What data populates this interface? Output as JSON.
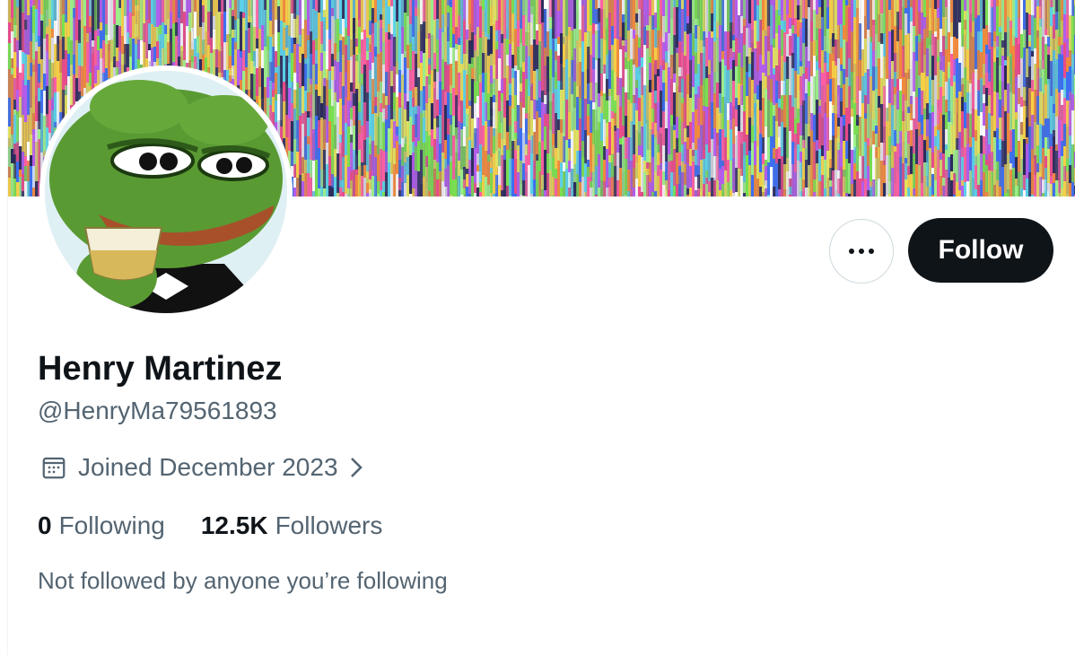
{
  "profile": {
    "display_name": "Henry Martinez",
    "handle": "@HenryMa79561893",
    "joined": "Joined December 2023",
    "following_count": "0",
    "following_label": "Following",
    "followers_count": "12.5K",
    "followers_label": "Followers",
    "mutuals_note": "Not followed by anyone you’re following"
  },
  "actions": {
    "follow_label": "Follow",
    "more_icon": "ellipsis-icon"
  },
  "icons": {
    "joined": "calendar-icon",
    "joined_link": "chevron-right-icon"
  },
  "colors": {
    "text_primary": "#0f1419",
    "text_secondary": "#536471",
    "follow_bg": "#0f1419",
    "border": "#cfd9de"
  }
}
